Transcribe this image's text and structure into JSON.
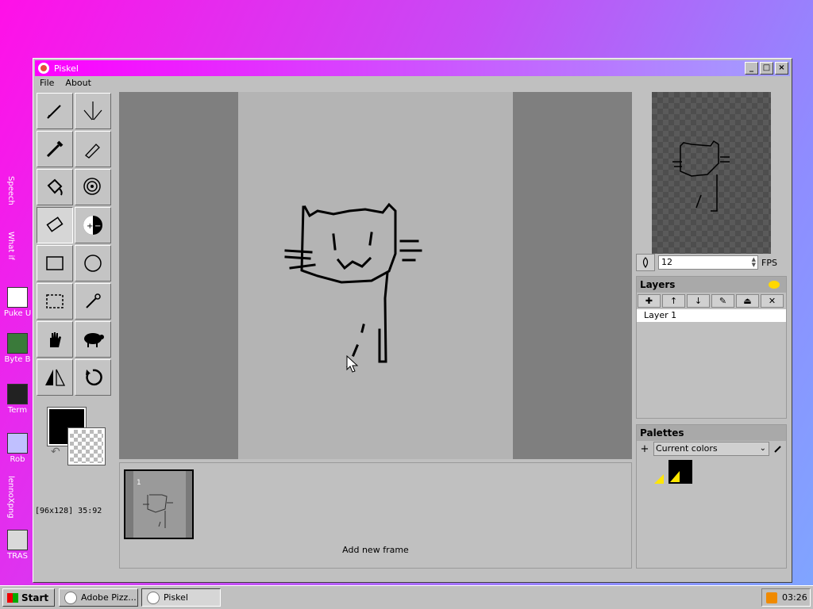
{
  "window": {
    "title": "Piskel"
  },
  "menu": {
    "items": [
      "File",
      "About"
    ]
  },
  "status": {
    "coords": "[96x128] 35:92"
  },
  "preview": {
    "fps_value": "12",
    "fps_label": "FPS"
  },
  "layers": {
    "title": "Layers",
    "items": [
      "Layer 1"
    ]
  },
  "palettes": {
    "title": "Palettes",
    "selected": "Current colors"
  },
  "frames": {
    "items": [
      "1"
    ],
    "add_label": "Add new frame"
  },
  "taskbar": {
    "start": "Start",
    "tasks": [
      "Adobe Pizz...",
      "Piskel"
    ],
    "clock": "03:26"
  },
  "desktop": {
    "labels": [
      "Speech",
      "What if",
      "Puke U",
      "Byte B",
      "Term",
      "Rob",
      "lennoXpng",
      "TRAS"
    ]
  },
  "colors": {
    "primary": "#000000",
    "title_start": "#ff00ff",
    "title_end": "#a0a0ff"
  }
}
